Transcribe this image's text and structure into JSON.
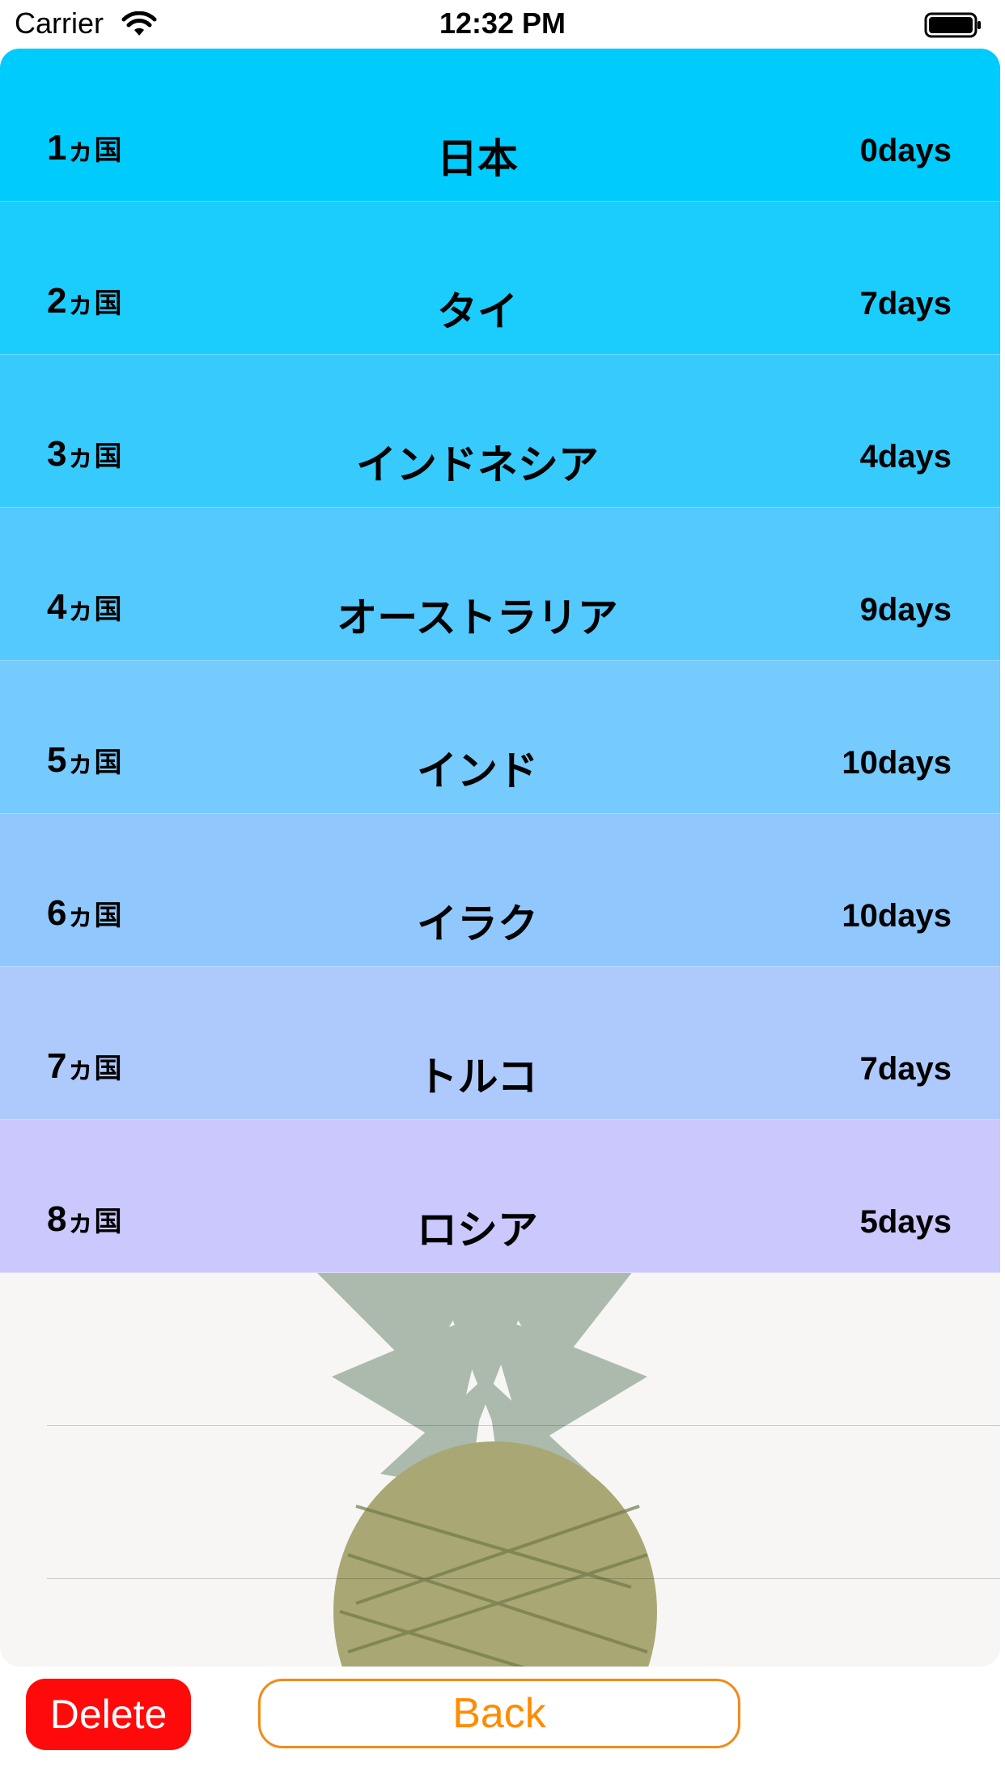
{
  "status_bar": {
    "carrier": "Carrier",
    "time": "12:32 PM",
    "wifi_icon": "wifi-icon",
    "battery_icon": "battery-full-icon"
  },
  "list": {
    "unit_suffix": "ヵ国",
    "rows": [
      {
        "number": "1",
        "country": "日本",
        "days": "0days",
        "color": "#00cbfd"
      },
      {
        "number": "2",
        "country": "タイ",
        "days": "7days",
        "color": "#1bcdfd"
      },
      {
        "number": "3",
        "country": "インドネシア",
        "days": "4days",
        "color": "#37cbfd"
      },
      {
        "number": "4",
        "country": "オーストラリア",
        "days": "9days",
        "color": "#53c9fd"
      },
      {
        "number": "5",
        "country": "インド",
        "days": "10days",
        "color": "#75cafe"
      },
      {
        "number": "6",
        "country": "イラク",
        "days": "10days",
        "color": "#90c8fd"
      },
      {
        "number": "7",
        "country": "トルコ",
        "days": "7days",
        "color": "#aecafd"
      },
      {
        "number": "8",
        "country": "ロシア",
        "days": "5days",
        "color": "#cbc8fd"
      }
    ],
    "background_image": "pineapple-photo"
  },
  "buttons": {
    "delete_label": "Delete",
    "back_label": "Back",
    "delete_color": "#ff0a0a",
    "back_color": "#ff8c00"
  }
}
